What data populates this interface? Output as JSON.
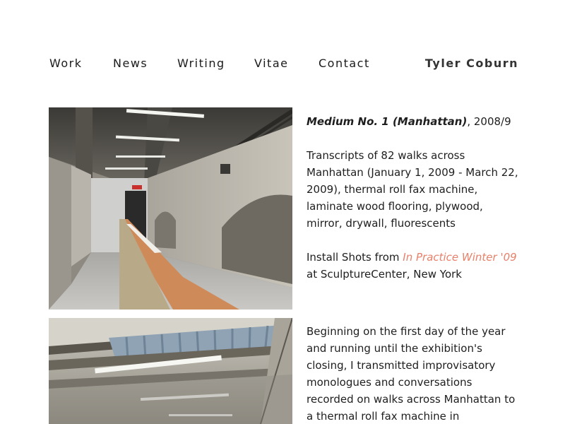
{
  "nav": {
    "items": [
      {
        "label": "Work"
      },
      {
        "label": "News"
      },
      {
        "label": "Writing"
      },
      {
        "label": "Vitae"
      },
      {
        "label": "Contact"
      }
    ],
    "site_name": "Tyler Coburn"
  },
  "artwork": {
    "title": "Medium No. 1 (Manhattan)",
    "year_text": ", 2008/9",
    "materials": "Transcripts of 82 walks across Manhattan (January 1, 2009 - March 22, 2009), thermal roll fax machine, laminate wood flooring, plywood, mirror, drywall, fluorescents",
    "install_prefix": "Install Shots from ",
    "exhibition_link": "In Practice Winter '09",
    "install_suffix": " at SculptureCenter, New York",
    "description": "Beginning on the first day of the year and running until the exhibition's closing, I transmitted improvisatory monologues and conversations recorded on walks across Manhattan to a thermal roll fax machine in"
  },
  "colors": {
    "link": "#e8806a",
    "text": "#1e1e1e"
  }
}
